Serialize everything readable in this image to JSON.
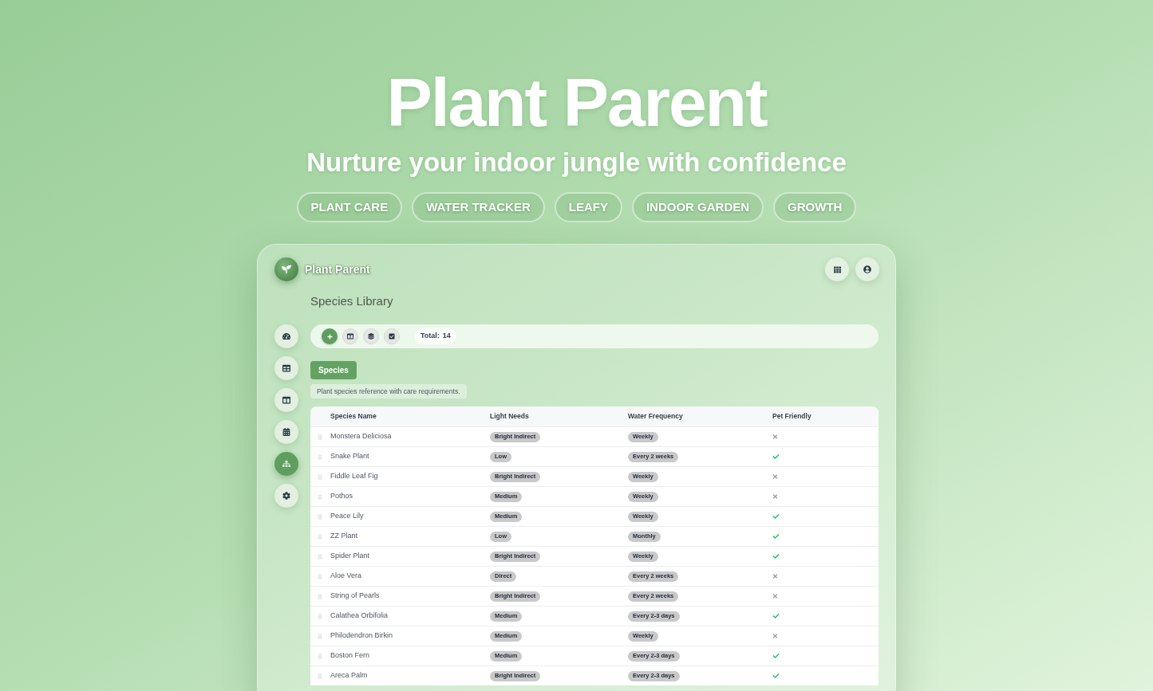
{
  "hero": {
    "title": "Plant Parent",
    "subtitle": "Nurture your indoor jungle with confidence",
    "tags": [
      "PLANT CARE",
      "WATER TRACKER",
      "LEAFY",
      "INDOOR GARDEN",
      "GROWTH"
    ]
  },
  "app": {
    "header": {
      "title": "Plant Parent"
    },
    "page_title": "Species Library",
    "sidebar": {
      "items": [
        {
          "selected": false
        },
        {
          "selected": false
        },
        {
          "selected": false
        },
        {
          "selected": false
        },
        {
          "selected": true
        },
        {
          "selected": false
        }
      ]
    },
    "toolbar": {
      "total": {
        "label": "Total:",
        "value": "14"
      }
    },
    "tabs": [
      {
        "label": "Species",
        "selected": true
      }
    ],
    "description": "Plant species reference with care requirements.",
    "table": {
      "columns": [
        "Species Name",
        "Light Needs",
        "Water Frequency",
        "Pet Friendly"
      ],
      "rows": [
        {
          "name": "Monstera Deliciosa",
          "light": "Bright Indirect",
          "water": "Weekly",
          "pet_friendly": false
        },
        {
          "name": "Snake Plant",
          "light": "Low",
          "water": "Every 2 weeks",
          "pet_friendly": true
        },
        {
          "name": "Fiddle Leaf Fig",
          "light": "Bright Indirect",
          "water": "Weekly",
          "pet_friendly": false
        },
        {
          "name": "Pothos",
          "light": "Medium",
          "water": "Weekly",
          "pet_friendly": false
        },
        {
          "name": "Peace Lily",
          "light": "Medium",
          "water": "Weekly",
          "pet_friendly": true
        },
        {
          "name": "ZZ Plant",
          "light": "Low",
          "water": "Monthly",
          "pet_friendly": true
        },
        {
          "name": "Spider Plant",
          "light": "Bright Indirect",
          "water": "Weekly",
          "pet_friendly": true
        },
        {
          "name": "Aloe Vera",
          "light": "Direct",
          "water": "Every 2 weeks",
          "pet_friendly": false
        },
        {
          "name": "String of Pearls",
          "light": "Bright Indirect",
          "water": "Every 2 weeks",
          "pet_friendly": false
        },
        {
          "name": "Calathea Orbifolia",
          "light": "Medium",
          "water": "Every 2-3 days",
          "pet_friendly": true
        },
        {
          "name": "Philodendron Birkin",
          "light": "Medium",
          "water": "Weekly",
          "pet_friendly": false
        },
        {
          "name": "Boston Fern",
          "light": "Medium",
          "water": "Every 2-3 days",
          "pet_friendly": true
        },
        {
          "name": "Areca Palm",
          "light": "Bright Indirect",
          "water": "Every 2-3 days",
          "pet_friendly": true
        }
      ]
    }
  }
}
